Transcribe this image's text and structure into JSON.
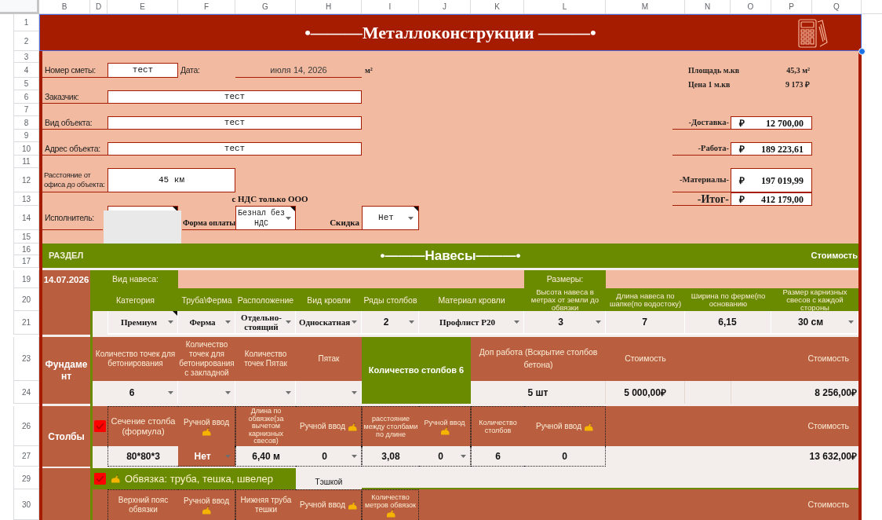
{
  "column_headers": [
    "B",
    "D",
    "E",
    "F",
    "G",
    "H",
    "I",
    "J",
    "K",
    "L",
    "M",
    "N",
    "O",
    "P",
    "Q"
  ],
  "row_headers": [
    "1",
    "2",
    "3",
    "4",
    "5",
    "6",
    "7",
    "8",
    "9",
    "10",
    "11",
    "12",
    "13",
    "14",
    "15",
    "16",
    "17",
    "19",
    "20",
    "21",
    "23",
    "24",
    "26",
    "27",
    "29",
    "30"
  ],
  "title": {
    "text": "•———Металлоконструкции ———•",
    "selected": true
  },
  "form": {
    "number": {
      "label": "Номер сметы:",
      "value": "тест"
    },
    "date": {
      "label": "Дата:",
      "value": "июля 14, 2026"
    },
    "area_unit": "м²",
    "customer": {
      "label": "Заказчик:",
      "value": "тест"
    },
    "object_type": {
      "label": "Вид объекта:",
      "value": "тест"
    },
    "object_address": {
      "label": "Адрес объекта:",
      "value": "тест"
    },
    "distance": {
      "label": "Расстояние от офиса до объекта:",
      "value": "45 км"
    },
    "vat_note": "с НДС только ООО",
    "contractor": {
      "label": "Исполнитель:",
      "has_note": true
    },
    "payment": {
      "label": "Форма оплаты",
      "value": "Безнал без НДС",
      "has_note": true
    },
    "discount": {
      "label": "Скидка",
      "value": "Нет",
      "has_note": true
    }
  },
  "summary": {
    "area": {
      "label": "Площадь м.кв",
      "value": "45,3 м²"
    },
    "price": {
      "label": "Цена 1 м.кв",
      "value": "9 173 ₽"
    },
    "totals": [
      {
        "label": "-Доставка-",
        "currency": "₽",
        "value": "12 700,00",
        "kind": "line"
      },
      {
        "label": "-Работа-",
        "currency": "₽",
        "value": "189 223,61",
        "kind": "line"
      },
      {
        "label": "-Материалы-",
        "currency": "₽",
        "value": "197 019,99",
        "kind": "line"
      },
      {
        "label": "-Итог-",
        "currency": "₽",
        "value": "412 179,00",
        "kind": "grand"
      }
    ]
  },
  "section": {
    "label": "РАЗДЕЛ",
    "title": "•———Навесы———•",
    "cost_label": "Стоимость"
  },
  "canopy": {
    "date": "14.07.2026",
    "type_label": "Вид навеса:",
    "sizes_label": "Размеры:",
    "columns": [
      {
        "header": "Категория",
        "value": "Премиум",
        "dropdown": true,
        "has_note": true
      },
      {
        "header": "Труба\\Ферма",
        "value": "Ферма",
        "dropdown": true,
        "has_note": false
      },
      {
        "header": "Расположение",
        "value": "Отдельно-стоящий",
        "dropdown": true,
        "has_note": false
      },
      {
        "header": "Вид кровли",
        "value": "Односкатная",
        "dropdown": true,
        "has_note": false
      },
      {
        "header": "Ряды столбов",
        "value": "2",
        "dropdown": true,
        "has_note": false
      },
      {
        "header": "Материал кровли",
        "value": "Профлист Р20",
        "dropdown": true,
        "has_note": false
      },
      {
        "header": "Высота навеса в метрах от земли до обвязки",
        "value": "3",
        "dropdown": true,
        "has_note": false
      },
      {
        "header": "Длина навеса по шапке(по водостоку)",
        "value": "7",
        "dropdown": false,
        "has_note": false
      },
      {
        "header": "Ширина по ферме(по основанию",
        "value": "6,15",
        "dropdown": false,
        "has_note": false
      },
      {
        "header": "Размер карнизных свесов с каждой стороны",
        "value": "30 см",
        "dropdown": true,
        "has_note": false
      }
    ]
  },
  "foundation": {
    "label": "Фундамент",
    "columns": [
      {
        "header": "Количество точек для бетонирования",
        "value": "6",
        "dropdown": true
      },
      {
        "header": "Количество точек для бетонирования с закладной",
        "dropdown": true
      },
      {
        "header": "Количество точек Пятак",
        "dropdown": true
      },
      {
        "header": "Пятак",
        "dropdown": true
      }
    ],
    "posts_count": "Количество столбов 6",
    "extra_work": {
      "header": "Доп работа (Вскрытие столбов бетона)",
      "value": "5 шт"
    },
    "cost": {
      "header": "Стоимость",
      "value": "5 000,00₽"
    },
    "total": {
      "header": "Стоимость",
      "value": "8 256,00₽"
    }
  },
  "posts": {
    "label": "Столбы",
    "checked": true,
    "columns": [
      {
        "header": "Сечение столба (формула)",
        "kind": "calc",
        "value": "80*80*3",
        "dropdown": false,
        "highlighted": false
      },
      {
        "header": "Ручной ввод",
        "kind": "manual",
        "value": "Нет",
        "dropdown": true,
        "highlighted": true
      },
      {
        "header": "Длина по обвязке(за вычетом карнизных свесов)",
        "kind": "calc",
        "value": "6,40 м",
        "dropdown": false,
        "highlighted": false
      },
      {
        "header": "Ручной ввод",
        "kind": "manual",
        "value": "0",
        "dropdown": true,
        "highlighted": false
      },
      {
        "header": "расстояние между столбами по длине",
        "kind": "calc",
        "value": "3,08",
        "dropdown": false,
        "highlighted": false
      },
      {
        "header": "Ручной ввод",
        "kind": "manual",
        "value": "0",
        "dropdown": true,
        "highlighted": false
      },
      {
        "header": "Количество столбов",
        "kind": "calc",
        "value": "6",
        "dropdown": false,
        "highlighted": false
      },
      {
        "header": "Ручной ввод",
        "kind": "manual",
        "value": "0",
        "dropdown": false,
        "highlighted": false
      }
    ],
    "total": {
      "header": "Стоимость",
      "value": "13 632,00₽"
    }
  },
  "strapping": {
    "checked": true,
    "title": "Обвязка: труба, тешка, швелер",
    "note": "Тэшкой",
    "columns": [
      {
        "header": "Верхний пояс обвязки",
        "kind": "calc"
      },
      {
        "header": "Ручной ввод",
        "kind": "manual"
      },
      {
        "header": "Нижняя труба тешки",
        "kind": "calc"
      },
      {
        "header": "Ручной ввод",
        "kind": "manual"
      },
      {
        "header": "Количество метров обвязок",
        "kind": "manual"
      }
    ],
    "total": {
      "header": "Стоимость"
    }
  }
}
